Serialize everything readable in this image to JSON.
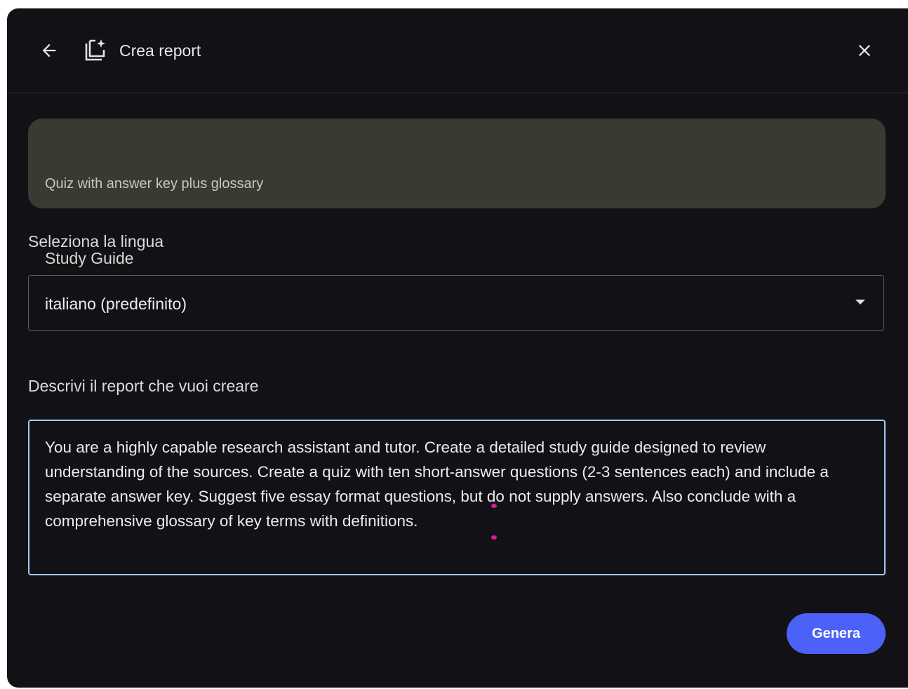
{
  "header": {
    "title": "Crea report",
    "back_icon": "arrow-back-icon",
    "report_icon": "report-sparkle-icon",
    "close_icon": "close-icon"
  },
  "report_type": {
    "title": "Study Guide",
    "description": "Quiz with answer key plus glossary"
  },
  "language": {
    "label": "Seleziona la lingua",
    "selected": "italiano (predefinito)"
  },
  "description": {
    "label": "Descrivi il report che vuoi creare",
    "value": "You are a highly capable research assistant and tutor. Create a detailed study guide designed to review understanding of the sources. Create a quiz with ten short-answer questions (2-3 sentences each) and include a separate answer key. Suggest five essay format questions, but do not supply answers. Also conclude with a comprehensive glossary of key terms with definitions."
  },
  "actions": {
    "generate_label": "Genera"
  },
  "colors": {
    "background": "#121216",
    "card": "#393a32",
    "focus_border": "#a8c7fa",
    "primary_button": "#4b61f7",
    "cursor_marker": "#e0189b"
  }
}
